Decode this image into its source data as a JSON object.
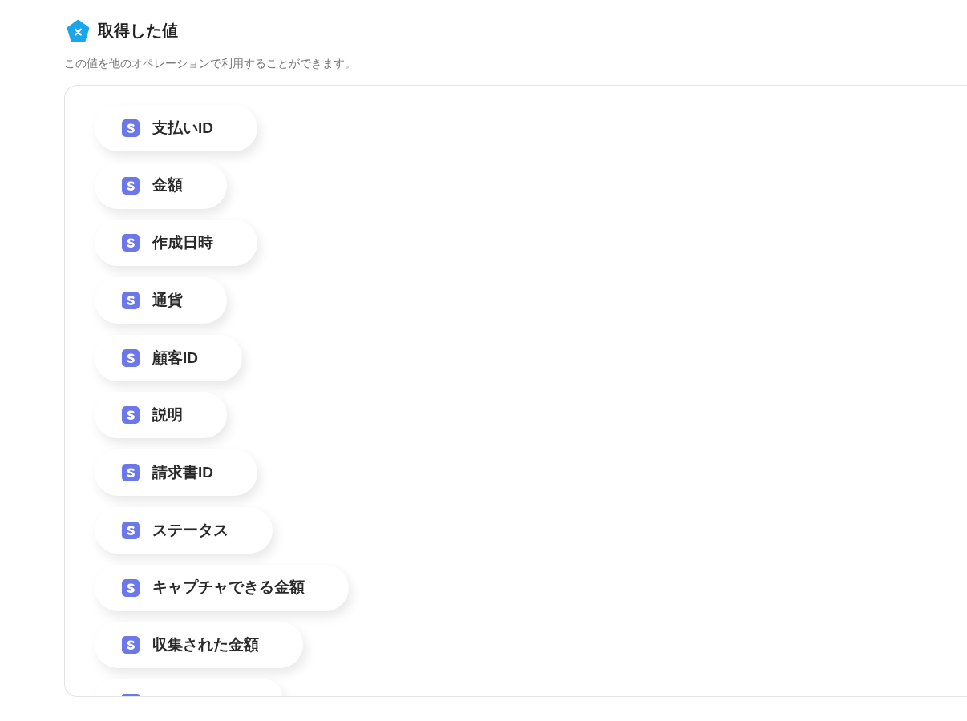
{
  "header": {
    "title": "取得した値",
    "description": "この値を他のオペレーションで利用することができます。"
  },
  "values": [
    {
      "kind": "value",
      "label": "支払いID"
    },
    {
      "kind": "value",
      "label": "金額"
    },
    {
      "kind": "value",
      "label": "作成日時"
    },
    {
      "kind": "value",
      "label": "通貨"
    },
    {
      "kind": "value",
      "label": "顧客ID"
    },
    {
      "kind": "value",
      "label": "説明"
    },
    {
      "kind": "value",
      "label": "請求書ID"
    },
    {
      "kind": "value",
      "label": "ステータス"
    },
    {
      "kind": "value",
      "label": "キャプチャできる金額"
    },
    {
      "kind": "value",
      "label": "収集された金額"
    },
    {
      "kind": "cut_off"
    }
  ]
}
